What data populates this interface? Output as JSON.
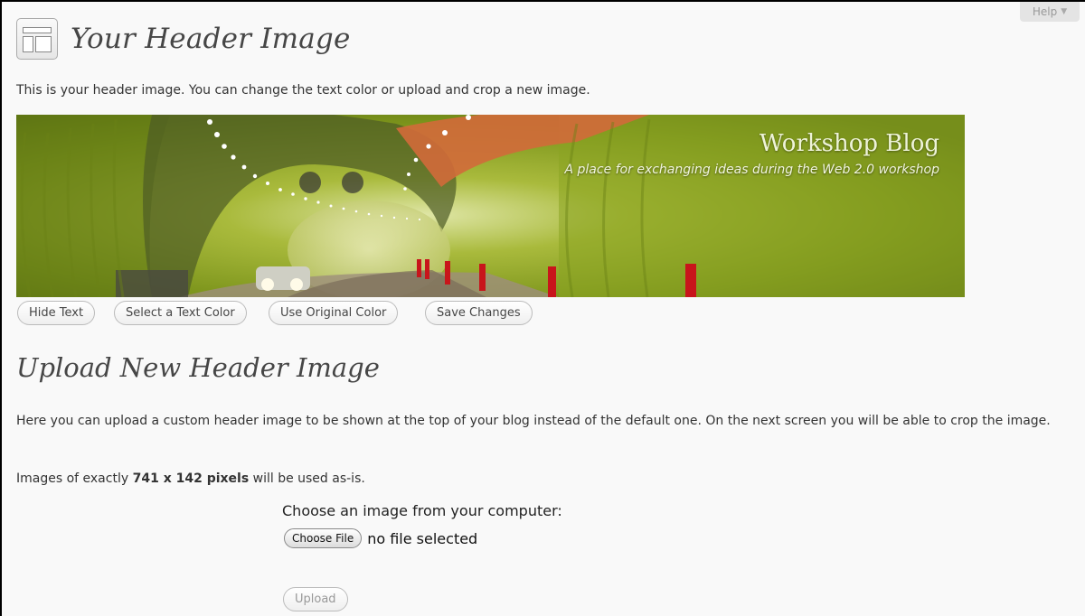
{
  "help": {
    "label": "Help"
  },
  "page": {
    "title": "Your Header Image",
    "description": "This is your header image. You can change the text color or upload and crop a new image."
  },
  "header_preview": {
    "blog_title": "Workshop Blog",
    "blog_tagline": "A place for exchanging ideas during the Web 2.0 workshop"
  },
  "actions": {
    "hide_text": "Hide Text",
    "select_color": "Select a Text Color",
    "use_original": "Use Original Color",
    "save_changes": "Save Changes"
  },
  "upload": {
    "title": "Upload New Header Image",
    "description": "Here you can upload a custom header image to be shown at the top of your blog instead of the default one. On the next screen you will be able to crop the image.",
    "size_prefix": "Images of exactly",
    "size_value": "741 x 142 pixels",
    "size_suffix": "will be used as-is.",
    "choose_label": "Choose an image from your computer:",
    "choose_file": "Choose File",
    "no_file": "no file selected",
    "upload_button": "Upload"
  },
  "colors": {
    "header_text": "#eef3d8",
    "tunnel_green": "#7f9a1c"
  },
  "icons": {
    "page_icon": "appearance-header-icon",
    "help_caret": "caret-down-icon"
  }
}
